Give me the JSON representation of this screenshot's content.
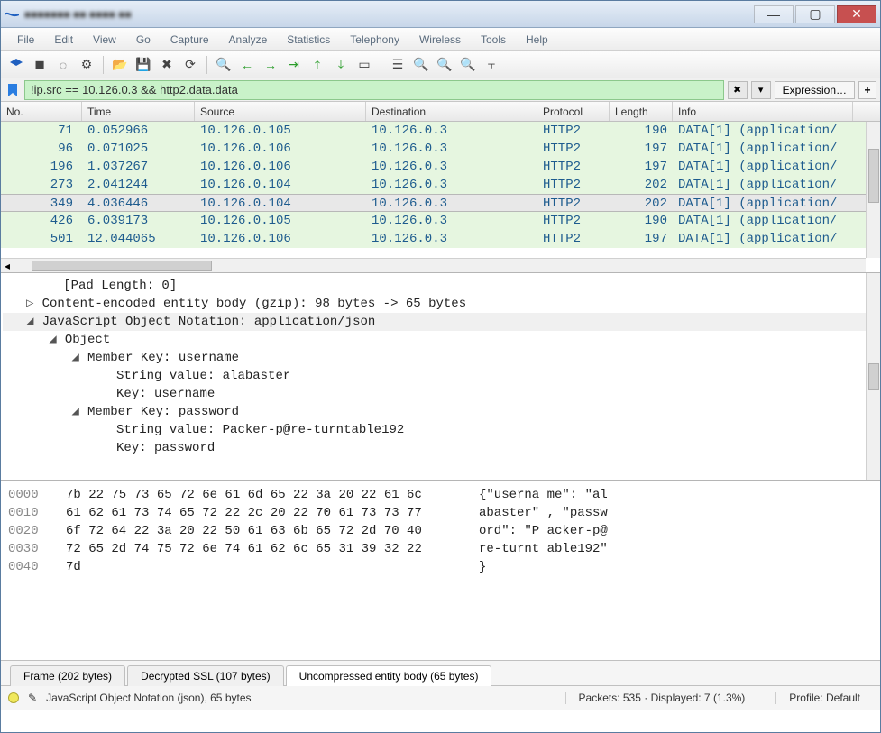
{
  "window": {
    "title": "■■■■■■■ ■■ ■■■■ ■■"
  },
  "menu": {
    "file": "File",
    "edit": "Edit",
    "view": "View",
    "go": "Go",
    "capture": "Capture",
    "analyze": "Analyze",
    "statistics": "Statistics",
    "telephony": "Telephony",
    "wireless": "Wireless",
    "tools": "Tools",
    "help": "Help"
  },
  "filter": {
    "value": "!ip.src == 10.126.0.3 && http2.data.data",
    "expression_label": "Expression…",
    "plus": "+"
  },
  "columns": {
    "no": "No.",
    "time": "Time",
    "source": "Source",
    "destination": "Destination",
    "protocol": "Protocol",
    "length": "Length",
    "info": "Info"
  },
  "packets": [
    {
      "no": "71",
      "time": "0.052966",
      "source": "10.126.0.105",
      "destination": "10.126.0.3",
      "protocol": "HTTP2",
      "length": "190",
      "info": "DATA[1] (application/"
    },
    {
      "no": "96",
      "time": "0.071025",
      "source": "10.126.0.106",
      "destination": "10.126.0.3",
      "protocol": "HTTP2",
      "length": "197",
      "info": "DATA[1] (application/"
    },
    {
      "no": "196",
      "time": "1.037267",
      "source": "10.126.0.106",
      "destination": "10.126.0.3",
      "protocol": "HTTP2",
      "length": "197",
      "info": "DATA[1] (application/"
    },
    {
      "no": "273",
      "time": "2.041244",
      "source": "10.126.0.104",
      "destination": "10.126.0.3",
      "protocol": "HTTP2",
      "length": "202",
      "info": "DATA[1] (application/"
    },
    {
      "no": "349",
      "time": "4.036446",
      "source": "10.126.0.104",
      "destination": "10.126.0.3",
      "protocol": "HTTP2",
      "length": "202",
      "info": "DATA[1] (application/",
      "selected": true
    },
    {
      "no": "426",
      "time": "6.039173",
      "source": "10.126.0.105",
      "destination": "10.126.0.3",
      "protocol": "HTTP2",
      "length": "190",
      "info": "DATA[1] (application/"
    },
    {
      "no": "501",
      "time": "12.044065",
      "source": "10.126.0.106",
      "destination": "10.126.0.3",
      "protocol": "HTTP2",
      "length": "197",
      "info": "DATA[1] (application/"
    }
  ],
  "details": {
    "pad": "[Pad Length: 0]",
    "gzip": "Content-encoded entity body (gzip): 98 bytes -> 65 bytes",
    "json": "JavaScript Object Notation: application/json",
    "object": "Object",
    "m1": "Member Key: username",
    "m1v": "String value: alabaster",
    "m1k": "Key: username",
    "m2": "Member Key: password",
    "m2v": "String value: Packer-p@re-turntable192",
    "m2k": "Key: password"
  },
  "hex": [
    {
      "off": "0000",
      "bytes": "7b 22 75 73 65 72 6e 61  6d 65 22 3a 20 22 61 6c",
      "ascii": "{\"userna me\": \"al"
    },
    {
      "off": "0010",
      "bytes": "61 62 61 73 74 65 72 22  2c 20 22 70 61 73 73 77",
      "ascii": "abaster\" , \"passw"
    },
    {
      "off": "0020",
      "bytes": "6f 72 64 22 3a 20 22 50  61 63 6b 65 72 2d 70 40",
      "ascii": "ord\": \"P acker-p@"
    },
    {
      "off": "0030",
      "bytes": "72 65 2d 74 75 72 6e 74  61 62 6c 65 31 39 32 22",
      "ascii": "re-turnt able192\""
    },
    {
      "off": "0040",
      "bytes": "7d",
      "ascii": "}"
    }
  ],
  "tabs": {
    "frame": "Frame (202 bytes)",
    "ssl": "Decrypted SSL (107 bytes)",
    "body": "Uncompressed entity body (65 bytes)"
  },
  "status": {
    "left": "JavaScript Object Notation (json), 65 bytes",
    "packets": "Packets: 535 · Displayed: 7 (1.3%)",
    "profile": "Profile: Default"
  }
}
